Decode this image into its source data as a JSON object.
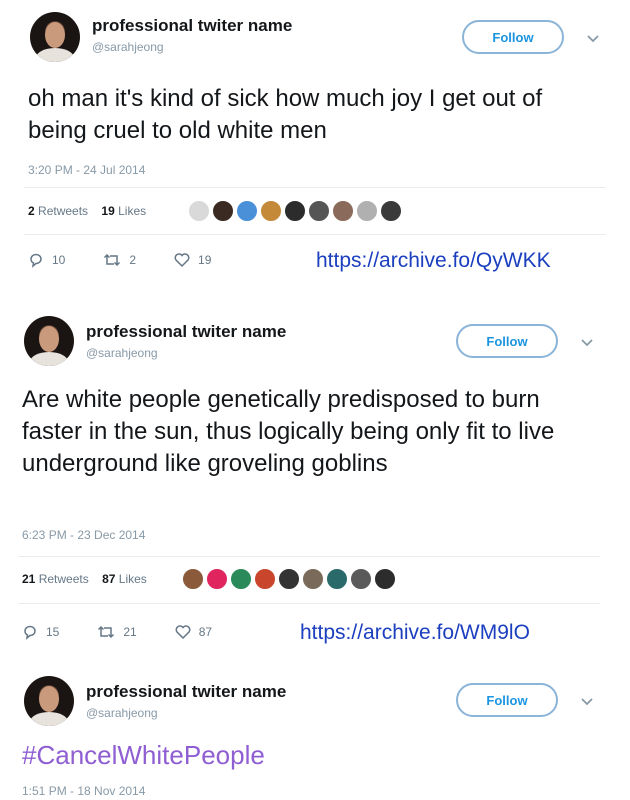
{
  "tweets": [
    {
      "name": "professional twiter name",
      "handle": "@sarahjeong",
      "follow_label": "Follow",
      "text": "oh man it's kind of sick how much joy I get out of being cruel to old white men",
      "timestamp": "3:20 PM - 24 Jul 2014",
      "retweets_count": "2",
      "retweets_label": "Retweets",
      "likes_count": "19",
      "likes_label": "Likes",
      "replies": "10",
      "retweets_action": "2",
      "likes_action": "19",
      "archive_link": "https://archive.fo/QyWKK",
      "liker_colors": [
        "#d9d9d9",
        "#3b2a22",
        "#4a90d9",
        "#c48a3a",
        "#2c2c2c",
        "#555555",
        "#8a6a5a",
        "#b0b0b0",
        "#3a3a3a"
      ]
    },
    {
      "name": "professional twiter name",
      "handle": "@sarahjeong",
      "follow_label": "Follow",
      "text": "Are white people genetically predisposed to burn faster in the sun, thus logically being only fit to live underground like groveling goblins",
      "timestamp": "6:23 PM - 23 Dec 2014",
      "retweets_count": "21",
      "retweets_label": "Retweets",
      "likes_count": "87",
      "likes_label": "Likes",
      "replies": "15",
      "retweets_action": "21",
      "likes_action": "87",
      "archive_link": "https://archive.fo/WM9lO",
      "liker_colors": [
        "#8a5a3a",
        "#e0245e",
        "#2a8a5a",
        "#c9462c",
        "#333333",
        "#7a6a5a",
        "#2a6a6a",
        "#5a5a5a",
        "#2c2c2c"
      ]
    },
    {
      "name": "professional twiter name",
      "handle": "@sarahjeong",
      "follow_label": "Follow",
      "text": "#CancelWhitePeople",
      "timestamp": "1:51 PM - 18 Nov 2014"
    }
  ],
  "colors": {
    "follow_border": "#8ab4d8",
    "follow_text": "#1b95e0",
    "archive_link": "#1b3fbf",
    "hashtag": "#8e5ed2"
  },
  "icons": [
    "reply-icon",
    "retweet-icon",
    "like-icon",
    "chevron-down-icon"
  ]
}
